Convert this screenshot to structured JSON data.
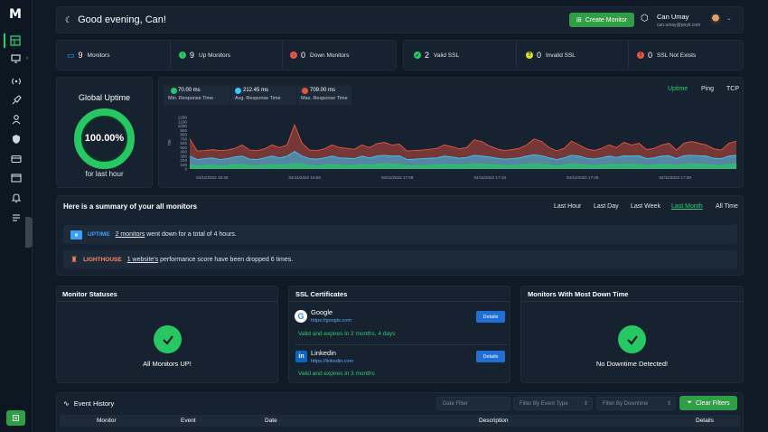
{
  "app": {
    "logo": "M"
  },
  "sidebar": {
    "items": [
      {
        "icon": "dashboard-icon",
        "active": true
      },
      {
        "icon": "monitor-icon"
      },
      {
        "icon": "broadcast-icon"
      },
      {
        "icon": "rocket-icon"
      },
      {
        "icon": "user-icon"
      },
      {
        "icon": "shield-icon"
      },
      {
        "icon": "credit-card-icon"
      },
      {
        "icon": "window-icon"
      },
      {
        "icon": "bell-icon"
      },
      {
        "icon": "list-icon"
      }
    ]
  },
  "header": {
    "greeting": "Good evening, Can!",
    "create_button": "Create Monitor",
    "user_name": "Can Umay",
    "user_email": "can.umay@peyk.com"
  },
  "stats": [
    {
      "value": "9",
      "label": "Monitors",
      "color": "#3aa0ff"
    },
    {
      "value": "9",
      "label": "Up Monitors",
      "color": "#27c864"
    },
    {
      "value": "0",
      "label": "Down Monitors",
      "color": "#e8553e"
    },
    {
      "value": "2",
      "label": "Valid SSL",
      "color": "#27c864"
    },
    {
      "value": "0",
      "label": "Invalid SSL",
      "color": "#d8e02a"
    },
    {
      "value": "0",
      "label": "SSL Not Exists",
      "color": "#e8553e"
    }
  ],
  "uptime": {
    "title": "Global Uptime",
    "value": "100.00%",
    "percent": 100,
    "subtitle": "for last hour"
  },
  "response": {
    "legend": [
      {
        "value": "70.00 ms",
        "label": "Min. Response Time",
        "color": "#27c864"
      },
      {
        "value": "212.45 ms",
        "label": "Avg. Response Time",
        "color": "#3ac7ff"
      },
      {
        "value": "709.00 ms",
        "label": "Max. Response Time",
        "color": "#e8553e"
      }
    ],
    "tabs": [
      "Uptime",
      "Ping",
      "TCP"
    ],
    "active_tab": "Uptime"
  },
  "chart_data": {
    "type": "area",
    "ylabel": "ms",
    "ylim": [
      0,
      1200
    ],
    "yticks": [
      1200,
      1100,
      1000,
      900,
      800,
      700,
      600,
      500,
      400,
      300,
      200,
      100,
      0
    ],
    "xticks": [
      "04/11/2022 16:48",
      "04/11/2022 16:58",
      "04/11/2022 17:08",
      "04/11/2022 17:18",
      "04/11/2022 17:28",
      "04/11/2022 17:38"
    ],
    "series": [
      {
        "name": "Max. Response Time",
        "color": "#e8553e",
        "values": [
          700,
          420,
          430,
          450,
          430,
          440,
          480,
          560,
          440,
          430,
          470,
          560,
          500,
          560,
          1030,
          600,
          440,
          430,
          470,
          560,
          500,
          480,
          460,
          560,
          500,
          590,
          620,
          560,
          580,
          420,
          430,
          440,
          460,
          480,
          560,
          520,
          470,
          500,
          680,
          640,
          540,
          470,
          430,
          450,
          480,
          560,
          700,
          640,
          500,
          420,
          480,
          650,
          560,
          470,
          430,
          480,
          560,
          500,
          620,
          560,
          600,
          450,
          480,
          560,
          600,
          440,
          600,
          640,
          600,
          560,
          470,
          440,
          600,
          650
        ]
      },
      {
        "name": "Avg. Response Time",
        "color": "#3ac7ff",
        "values": [
          300,
          220,
          240,
          260,
          220,
          240,
          280,
          300,
          230,
          220,
          260,
          300,
          260,
          300,
          410,
          300,
          240,
          230,
          260,
          300,
          260,
          250,
          240,
          300,
          260,
          300,
          320,
          300,
          310,
          220,
          230,
          240,
          250,
          260,
          300,
          280,
          250,
          270,
          320,
          300,
          280,
          250,
          230,
          240,
          260,
          300,
          330,
          310,
          260,
          220,
          260,
          320,
          300,
          250,
          230,
          260,
          300,
          270,
          310,
          300,
          310,
          240,
          260,
          300,
          310,
          240,
          310,
          320,
          310,
          300,
          250,
          240,
          300,
          320
        ]
      },
      {
        "name": "Min. Response Time",
        "color": "#27c864",
        "values": [
          90,
          70,
          80,
          90,
          70,
          80,
          100,
          110,
          80,
          70,
          90,
          110,
          90,
          110,
          130,
          110,
          80,
          70,
          90,
          110,
          90,
          80,
          80,
          110,
          90,
          110,
          120,
          110,
          110,
          70,
          80,
          80,
          90,
          90,
          110,
          100,
          90,
          100,
          120,
          110,
          100,
          90,
          80,
          80,
          90,
          110,
          120,
          110,
          90,
          70,
          90,
          120,
          110,
          90,
          80,
          90,
          110,
          100,
          110,
          110,
          110,
          80,
          90,
          110,
          110,
          80,
          110,
          120,
          110,
          110,
          90,
          80,
          110,
          120
        ]
      }
    ]
  },
  "summary": {
    "title": "Here is a summary of your all monitors",
    "ranges": [
      "Last Hour",
      "Last Day",
      "Last Week",
      "Last Month",
      "All Time"
    ],
    "active_range": "Last Month",
    "rows": [
      {
        "tag": "UPTIME",
        "tag_color": "#3aa0ff",
        "link": "2 monitors",
        "text": "went down for a total of 4 hours."
      },
      {
        "tag": "LIGHTHOUSE",
        "tag_color": "#ff8a5b",
        "link": "1 website's",
        "text": "performance score have been dropped 6 times."
      }
    ]
  },
  "monitor_statuses": {
    "title": "Monitor Statuses",
    "message": "All Monitors UP!"
  },
  "ssl": {
    "title": "SSL Certificates",
    "items": [
      {
        "name": "Google",
        "url": "https://google.com",
        "status": "Valid and expires in 2 months, 4 days",
        "button": "Details"
      },
      {
        "name": "Linkedin",
        "url": "https://linkedin.com",
        "status": "Valid and expires in 3 months",
        "button": "Details"
      }
    ]
  },
  "downtime": {
    "title": "Monitors With Most Down Time",
    "message": "No Downtime Detected!"
  },
  "events": {
    "title": "Event History",
    "date_filter": "Date Filter",
    "type_filter": "Filter By Event Type",
    "downtime_filter": "Filter By Downtime",
    "clear_button": "Clear Filters",
    "columns": [
      "Monitor",
      "Event",
      "Date",
      "Description",
      "Details"
    ]
  }
}
